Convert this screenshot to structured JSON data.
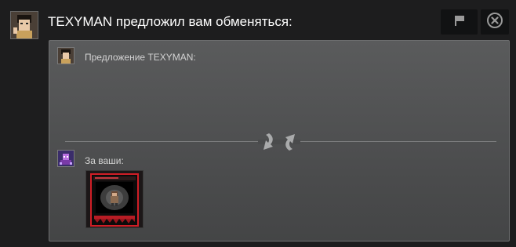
{
  "header": {
    "title": "TEXYMAN предложил вам обменяться:",
    "report_icon": "flag-icon",
    "close_icon": "close-circle-icon"
  },
  "offer": {
    "their_label": "Предложение TEXYMAN:",
    "your_label": "За ваши:",
    "swap_icon": "swap-arrows-icon",
    "items": [
      {
        "name": "trading-card",
        "icon": "card-icon"
      }
    ]
  },
  "colors": {
    "background": "#1d1d1e",
    "panel": "#505152",
    "card_border": "#e0202a"
  }
}
